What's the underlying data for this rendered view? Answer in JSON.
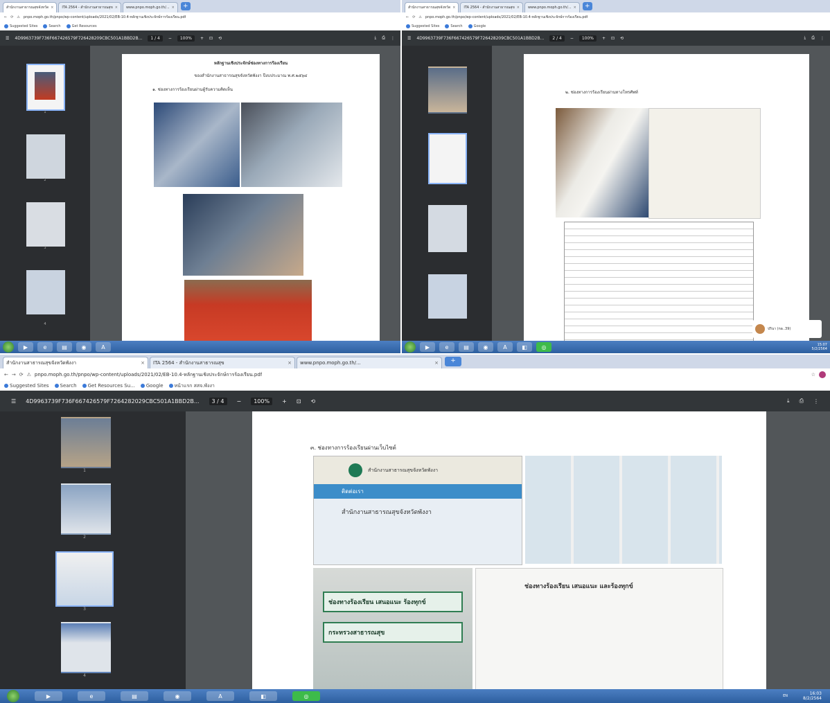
{
  "screens": {
    "top_left": {
      "tabs": [
        "สำนักงานสาธารณสุขจังหวัด",
        "ITA 2564 - สำนักงานสาธารณสุข",
        "www.pnpo.moph.go.th/..."
      ],
      "url": "pnpo.moph.go.th/pnpo/wp-content/uploads/2021/02/EB-10.4-หลักฐานเชิงประจักษ์การร้องเรียน.pdf",
      "file_name": "4D9963739F736F667426579F726428209CBC501A1BBD2B...",
      "page_indicator": "1 / 4",
      "zoom": "100%",
      "page_title": "หลักฐานเชิงประจักษ์ช่องทางการร้องเรียน",
      "page_subtitle": "ของสำนักงานสาธารณสุขจังหวัดพังงา ปีงบประมาณ พ.ศ.๒๕๖๔",
      "section_label": "๑. ช่องทางการร้องเรียนผ่านตู้รับความคิดเห็น",
      "thumb_numbers": [
        "1",
        "2",
        "3",
        "4"
      ]
    },
    "top_right": {
      "tabs": [
        "สำนักงานสาธารณสุขจังหวัด",
        "ITA 2564 - สำนักงานสาธารณสุข",
        "www.pnpo.moph.go.th/..."
      ],
      "url": "pnpo.moph.go.th/pnpo/wp-content/uploads/2021/02/EB-10.4-หลักฐานเชิงประจักษ์การร้องเรียน.pdf",
      "file_name": "4D9963739F736F667426579F726428209CBC501A1BBD2B...",
      "page_indicator": "2 / 4",
      "zoom": "100%",
      "section_label": "๒. ช่องทางการร้องเรียนผ่านทางโทรศัพท์",
      "chat_name": "ปรินา (na..39)",
      "clock_time": "15:07",
      "clock_date": "5/2/2564"
    },
    "bottom": {
      "tabs": [
        "สำนักงานสาธารณสุขจังหวัดพังงา",
        "ITA 2564 - สำนักงานสาธารณสุข",
        "www.pnpo.moph.go.th/..."
      ],
      "url": "pnpo.moph.go.th/pnpo/wp-content/uploads/2021/02/EB-10.4-หลักฐานเชิงประจักษ์การร้องเรียน.pdf",
      "bookmarks": [
        "Suggested Sites",
        "Search",
        "Get Resources Su...",
        "Google",
        "หน้าแรก สสจ.พังงา"
      ],
      "file_name": "4D9963739F736F667426579F7264282029CBC501A1BBD2B...",
      "page_indicator": "3 / 4",
      "zoom": "100%",
      "section_label": "๓. ช่องทางการร้องเรียนผ่านเว็บไซต์",
      "site_name": "สำนักงานสาธารณสุขจังหวัดพังงา",
      "site_nav": "ติดต่อเรา",
      "site_heading": "สำนักงานสาธารณสุขจังหวัดพังงา",
      "banner1": "ช่องทางร้องเรียน เสนอแนะ ร้องทุกข์",
      "banner2": "กระทรวงสาธารณสุข",
      "right_heading": "ช่องทางร้องเรียน เสนอแนะ และร้องทุกข์",
      "thumb_numbers": [
        "1",
        "2",
        "3",
        "4"
      ],
      "clock_time": "16:03",
      "clock_date": "8/2/2564",
      "tray_lang": "EN"
    }
  }
}
